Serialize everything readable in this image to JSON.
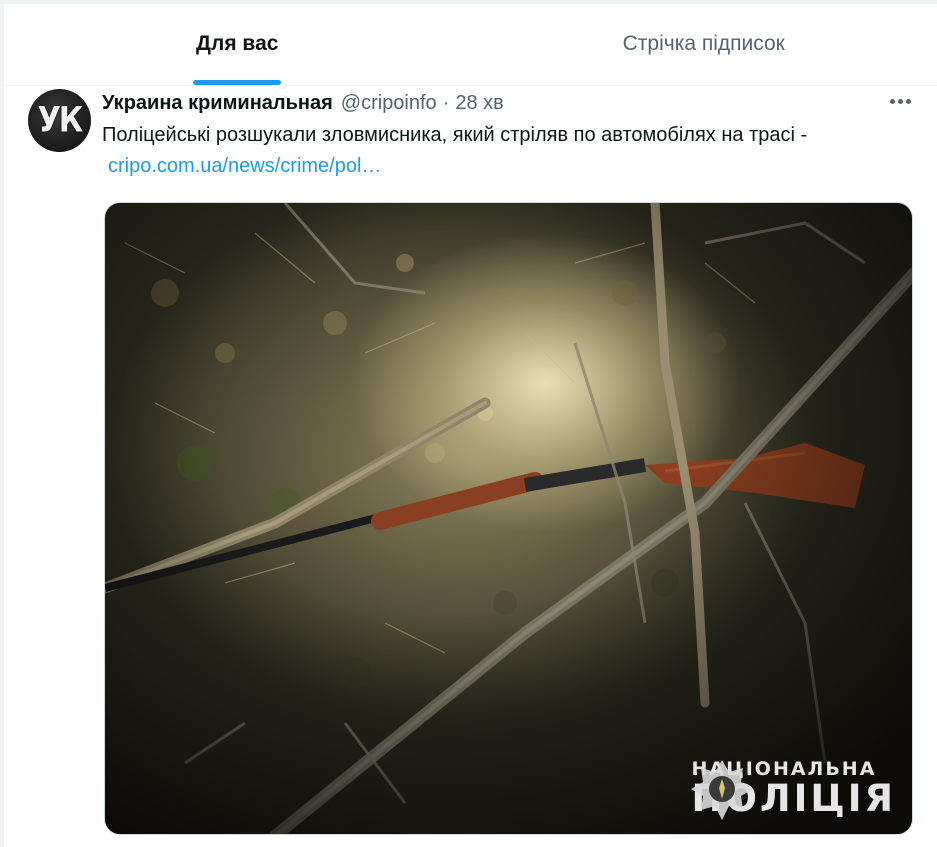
{
  "tabs": [
    {
      "label": "Для вас",
      "active": true
    },
    {
      "label": "Стрічка підписок",
      "active": false
    }
  ],
  "tweet": {
    "avatar_text": "УК",
    "author_name": "Украина криминальная",
    "author_handle": "@cripoinfo",
    "separator": "·",
    "time": "28 хв",
    "text": "Поліцейські розшукали зловмисника, який стріляв по автомобілях на трасі -",
    "link": "cripo.com.ua/news/crime/pol…",
    "media": {
      "watermark_line1": "НАЦІОНАЛЬНА",
      "watermark_line2": "ПОЛІЦІЯ"
    }
  },
  "colors": {
    "accent": "#1d9bf0",
    "secondary_text": "#536471",
    "primary_text": "#0f1419"
  },
  "icons": {
    "more": "more-horizontal-icon",
    "police_badge": "police-badge-icon"
  }
}
